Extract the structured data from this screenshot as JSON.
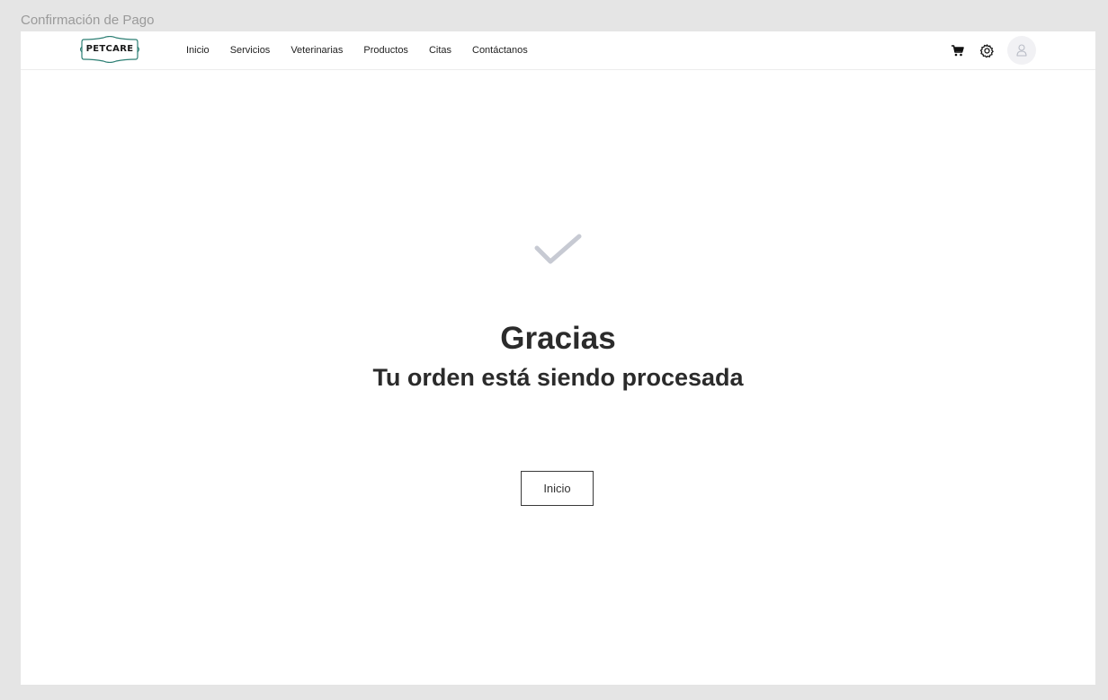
{
  "frame": {
    "label": "Confirmación de Pago"
  },
  "navbar": {
    "logo_text": "PETCARE",
    "links": [
      "Inicio",
      "Servicios",
      "Veterinarias",
      "Productos",
      "Citas",
      "Contáctanos"
    ],
    "icons": [
      "cart-icon",
      "settings-icon",
      "user-icon"
    ]
  },
  "confirmation": {
    "icon": "checkmark-icon",
    "title": "Gracias",
    "subtitle": "Tu orden está siendo procesada",
    "button_label": "Inicio"
  },
  "colors": {
    "background": "#e5e5e5",
    "panel": "#ffffff",
    "text": "#2b2b2b",
    "check": "#c7cad3",
    "avatar_bg": "#f1f1f4"
  }
}
